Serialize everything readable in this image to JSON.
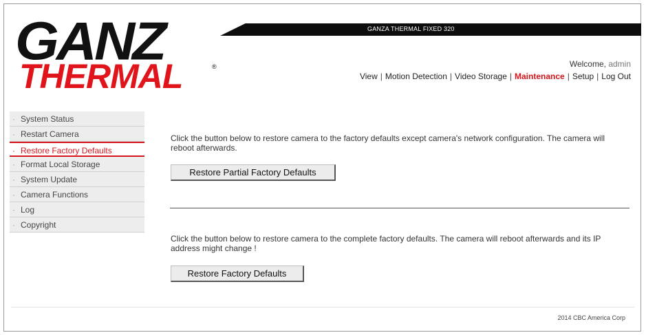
{
  "brand": {
    "logo_top": "GANZ",
    "logo_bottom": "THERMAL",
    "registered": "®"
  },
  "product_title": "GANZA THERMAL FIXED 320",
  "welcome": {
    "prefix": "Welcome,",
    "user": "admin"
  },
  "topnav": [
    {
      "label": "View"
    },
    {
      "label": "Motion Detection"
    },
    {
      "label": "Video Storage"
    },
    {
      "label": "Maintenance",
      "active": true
    },
    {
      "label": "Setup"
    },
    {
      "label": "Log Out"
    }
  ],
  "sidebar": {
    "items": [
      {
        "label": "System Status"
      },
      {
        "label": "Restart Camera"
      },
      {
        "label": "Restore Factory Defaults",
        "active": true
      },
      {
        "label": "Format Local Storage"
      },
      {
        "label": "System Update"
      },
      {
        "label": "Camera Functions"
      },
      {
        "label": "Log"
      },
      {
        "label": "Copyright"
      }
    ]
  },
  "main": {
    "partial": {
      "description": "Click the button below to restore camera to the factory defaults except camera's network configuration. The camera will reboot afterwards.",
      "button_label": "Restore Partial Factory Defaults"
    },
    "full": {
      "description": "Click the button below to restore camera to the complete factory defaults. The camera will reboot afterwards and its IP address might change !",
      "button_label": "Restore Factory Defaults"
    }
  },
  "footer": {
    "copyright": "2014 CBC America Corp"
  },
  "colors": {
    "accent": "#d7141b",
    "header_bar": "#0d0d0d",
    "sidebar_bg": "#ededed"
  }
}
